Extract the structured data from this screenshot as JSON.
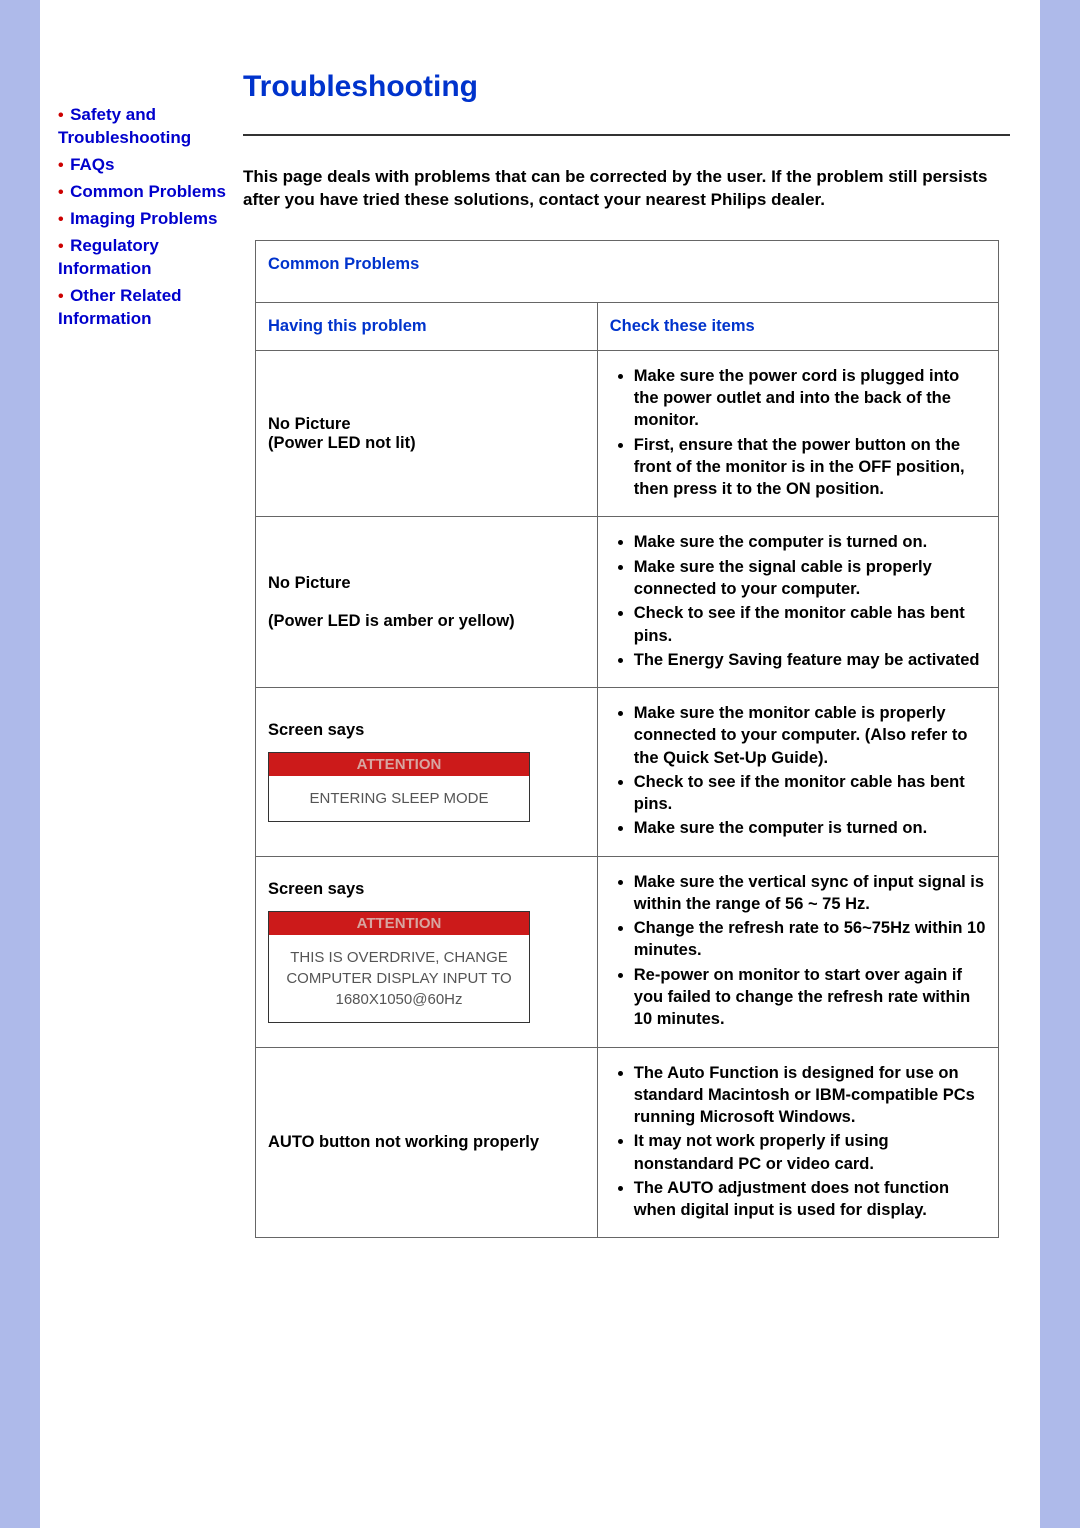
{
  "sidebar": {
    "items": [
      {
        "label": "Safety and Troubleshooting"
      },
      {
        "label": "FAQs"
      },
      {
        "label": "Common Problems"
      },
      {
        "label": "Imaging Problems"
      },
      {
        "label": "Regulatory Information"
      },
      {
        "label": "Other Related Information"
      }
    ]
  },
  "main": {
    "title": "Troubleshooting",
    "intro": "This page deals with problems that can be corrected by the user. If the problem still persists after you have tried these solutions, contact your nearest Philips dealer."
  },
  "table": {
    "section_title": "Common Problems",
    "col1": "Having this problem",
    "col2": "Check these items",
    "rows": [
      {
        "problem_line1": "No Picture",
        "problem_line2": "(Power LED not lit)",
        "checks": [
          "Make sure the power cord is plugged into the power outlet and into the back of the monitor.",
          "First, ensure that the power button on the front of the monitor is in the OFF position, then press it to the ON position."
        ]
      },
      {
        "problem_line1": "No Picture",
        "problem_line2": "(Power LED is amber or yellow)",
        "checks": [
          "Make sure the computer is turned on.",
          "Make sure the signal cable is properly connected to your computer.",
          "Check to see if the monitor cable has bent pins.",
          "The Energy Saving feature may be activated"
        ]
      },
      {
        "problem_label": "Screen says",
        "attention_label": "ATTENTION",
        "attention_body": "ENTERING SLEEP MODE",
        "checks": [
          "Make sure the monitor cable is properly connected to your computer. (Also refer to the Quick Set-Up Guide).",
          "Check to see if the monitor cable has bent pins.",
          "Make sure the computer is turned on."
        ]
      },
      {
        "problem_label": "Screen says",
        "attention_label": "ATTENTION",
        "attention_body": "THIS IS OVERDRIVE, CHANGE COMPUTER DISPLAY INPUT TO 1680X1050@60Hz",
        "checks": [
          "Make sure the vertical sync of input signal is within the range of 56 ~ 75 Hz.",
          "Change the refresh rate to 56~75Hz within 10 minutes.",
          "Re-power on monitor to start over again if you failed to change the refresh rate within 10 minutes."
        ]
      },
      {
        "problem_line1": "AUTO button not working properly",
        "checks": [
          "The Auto Function is designed for use on standard Macintosh or IBM-compatible PCs running Microsoft Windows.",
          "It may not work properly if using nonstandard PC or video card.",
          "The AUTO adjustment does not function when digital input is used for display."
        ]
      }
    ]
  }
}
